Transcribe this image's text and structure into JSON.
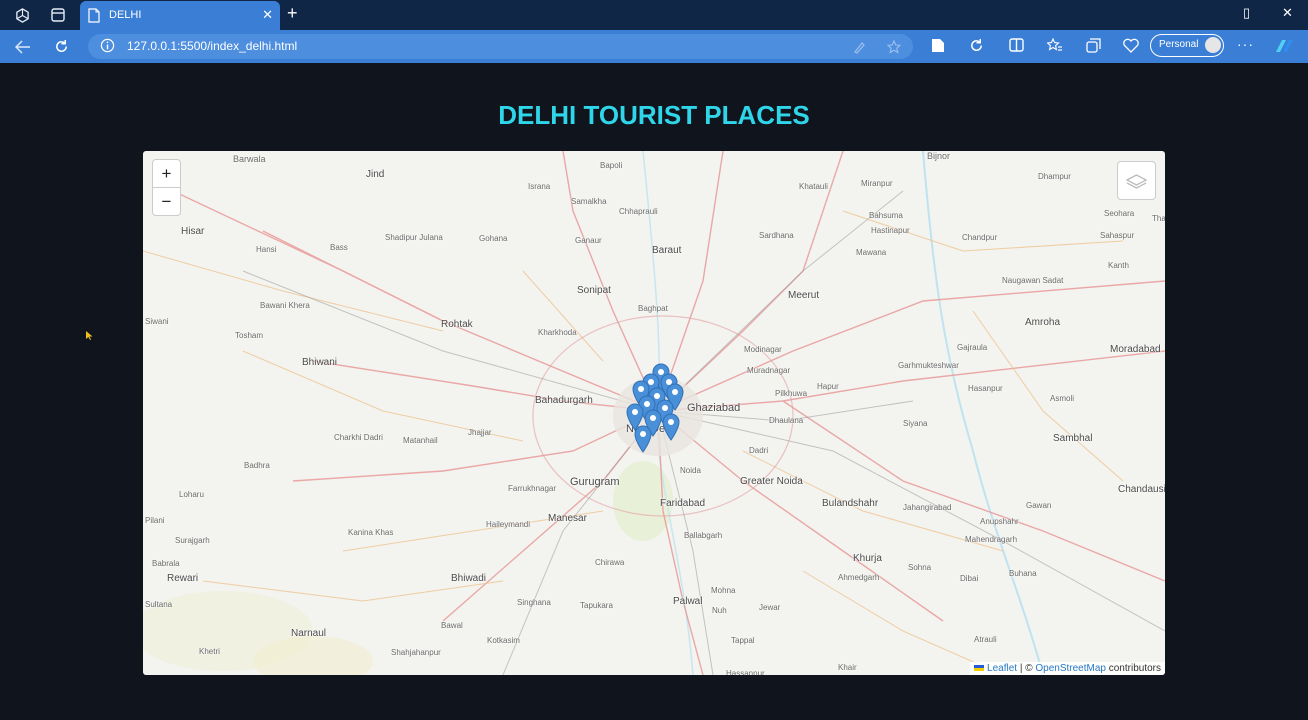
{
  "browser": {
    "tab_title": "DELHI",
    "url": "127.0.0.1:5500/index_delhi.html",
    "profile_label": "Personal",
    "more_label": "···",
    "new_tab_label": "+"
  },
  "page": {
    "heading": "DELHI TOURIST PLACES"
  },
  "map": {
    "zoom_in": "+",
    "zoom_out": "−",
    "attribution": {
      "leaflet": "Leaflet",
      "separator": " | © ",
      "osm": "OpenStreetMap",
      "suffix": " contributors"
    },
    "labels": [
      {
        "name": "Barwala",
        "size": 9
      },
      {
        "name": "Jind",
        "size": 10
      },
      {
        "name": "Israna",
        "size": 8
      },
      {
        "name": "Bapoli",
        "size": 8
      },
      {
        "name": "Bijnor",
        "size": 9
      },
      {
        "name": "Dhampur",
        "size": 8
      },
      {
        "name": "Khatauli",
        "size": 8
      },
      {
        "name": "Miranpur",
        "size": 8
      },
      {
        "name": "Samalkha",
        "size": 8
      },
      {
        "name": "Chhaprauli",
        "size": 8
      },
      {
        "name": "Bahsuma",
        "size": 8
      },
      {
        "name": "Seohara",
        "size": 8
      },
      {
        "name": "Thakurdwara",
        "size": 8
      },
      {
        "name": "Hisar",
        "size": 10
      },
      {
        "name": "Hansi",
        "size": 8
      },
      {
        "name": "Bass",
        "size": 8
      },
      {
        "name": "Shadipur Julana",
        "size": 8
      },
      {
        "name": "Gohana",
        "size": 8
      },
      {
        "name": "Ganaur",
        "size": 8
      },
      {
        "name": "Baraut",
        "size": 10
      },
      {
        "name": "Sardhana",
        "size": 8
      },
      {
        "name": "Hastinapur",
        "size": 8
      },
      {
        "name": "Chandpur",
        "size": 8
      },
      {
        "name": "Sahaspur",
        "size": 8
      },
      {
        "name": "Mawana",
        "size": 8
      },
      {
        "name": "Kanth",
        "size": 8
      },
      {
        "name": "Sonipat",
        "size": 10
      },
      {
        "name": "Meerut",
        "size": 10
      },
      {
        "name": "Naugawan Sadat",
        "size": 8
      },
      {
        "name": "Bawani Khera",
        "size": 8
      },
      {
        "name": "Baghpat",
        "size": 8
      },
      {
        "name": "Siwani",
        "size": 8
      },
      {
        "name": "Tosham",
        "size": 8
      },
      {
        "name": "Rohtak",
        "size": 10
      },
      {
        "name": "Kharkhoda",
        "size": 8
      },
      {
        "name": "Amroha",
        "size": 10
      },
      {
        "name": "Moradabad",
        "size": 10
      },
      {
        "name": "Bhiwani",
        "size": 10
      },
      {
        "name": "Modinagar",
        "size": 8
      },
      {
        "name": "Gajraula",
        "size": 8
      },
      {
        "name": "Muradnagar",
        "size": 8
      },
      {
        "name": "Garhmukteshwar",
        "size": 8
      },
      {
        "name": "Hasanpur",
        "size": 8
      },
      {
        "name": "Pilkhuwa",
        "size": 8
      },
      {
        "name": "Hapur",
        "size": 8
      },
      {
        "name": "Bahadurgarh",
        "size": 10
      },
      {
        "name": "Ghaziabad",
        "size": 11
      },
      {
        "name": "Asmoli",
        "size": 8
      },
      {
        "name": "Dhaulana",
        "size": 8
      },
      {
        "name": "Siyana",
        "size": 8
      },
      {
        "name": "New Delhi",
        "size": 11
      },
      {
        "name": "Charkhi Dadri",
        "size": 8
      },
      {
        "name": "Matanhail",
        "size": 8
      },
      {
        "name": "Jhajjar",
        "size": 8
      },
      {
        "name": "Sambhal",
        "size": 10
      },
      {
        "name": "Dadri",
        "size": 8
      },
      {
        "name": "Noida",
        "size": 8
      },
      {
        "name": "Badhra",
        "size": 8
      },
      {
        "name": "Greater Noida",
        "size": 10
      },
      {
        "name": "Gurugram",
        "size": 11
      },
      {
        "name": "Farrukhnagar",
        "size": 8
      },
      {
        "name": "Loharu",
        "size": 8
      },
      {
        "name": "Bulandshahr",
        "size": 10
      },
      {
        "name": "Chandausi",
        "size": 10
      },
      {
        "name": "Jahangirabad",
        "size": 8
      },
      {
        "name": "Gawan",
        "size": 8
      },
      {
        "name": "Faridabad",
        "size": 10
      },
      {
        "name": "Manesar",
        "size": 10
      },
      {
        "name": "Pilani",
        "size": 8
      },
      {
        "name": "Haileymandi",
        "size": 8
      },
      {
        "name": "Anupshahr",
        "size": 8
      },
      {
        "name": "Kanina Khas",
        "size": 8
      },
      {
        "name": "Surajgarh",
        "size": 8
      },
      {
        "name": "Ballabgarh",
        "size": 8
      },
      {
        "name": "Mahendragarh",
        "size": 8
      },
      {
        "name": "Khurja",
        "size": 10
      },
      {
        "name": "Babrala",
        "size": 8
      },
      {
        "name": "Chirawa",
        "size": 8
      },
      {
        "name": "Sohna",
        "size": 8
      },
      {
        "name": "Ahmedgarh",
        "size": 8
      },
      {
        "name": "Buhana",
        "size": 8
      },
      {
        "name": "Rewari",
        "size": 10
      },
      {
        "name": "Bhiwadi",
        "size": 10
      },
      {
        "name": "Mohna",
        "size": 8
      },
      {
        "name": "Dibai",
        "size": 8
      },
      {
        "name": "Sultana",
        "size": 8
      },
      {
        "name": "Palwal",
        "size": 10
      },
      {
        "name": "Singhana",
        "size": 8
      },
      {
        "name": "Tapukara",
        "size": 8
      },
      {
        "name": "Nuh",
        "size": 8
      },
      {
        "name": "Jewar",
        "size": 8
      },
      {
        "name": "Bawal",
        "size": 8
      },
      {
        "name": "Narnaul",
        "size": 10
      },
      {
        "name": "Kotkasim",
        "size": 8
      },
      {
        "name": "Tappal",
        "size": 8
      },
      {
        "name": "Atrauli",
        "size": 8
      },
      {
        "name": "Khetri",
        "size": 8
      },
      {
        "name": "Shahjahanpur",
        "size": 8
      },
      {
        "name": "Hassanpur",
        "size": 8
      },
      {
        "name": "Khair",
        "size": 8
      }
    ],
    "marker_count": 12
  },
  "colors": {
    "heading": "#2fd6ea",
    "page_bg": "#10141c",
    "tab_active": "#3b7ed6",
    "marker": "#4a90d9"
  }
}
